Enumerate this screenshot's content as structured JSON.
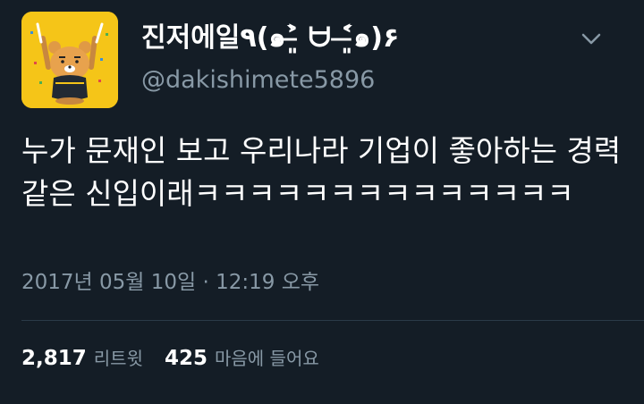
{
  "tweet": {
    "author": {
      "display_name": "진저에일٩(๑˃̶͈̀ ᗨ ˂̶͈́๑)۶",
      "handle": "@dakishimete5896",
      "avatar_icon": "ryan-character-avatar"
    },
    "menu_icon": "chevron-down-icon",
    "text": "누가 문재인 보고 우리나라 기업이 좋아하는 경력같은 신입이래ㅋㅋㅋㅋㅋㅋㅋㅋㅋㅋㅋㅋㅋㅋ",
    "timestamp": "2017년 05월 10일 · 12:19 오후",
    "stats": {
      "retweets_count": "2,817",
      "retweets_label": "리트윗",
      "likes_count": "425",
      "likes_label": "마음에 들어요"
    }
  },
  "colors": {
    "background": "#141d26",
    "primary_text": "#ffffff",
    "secondary_text": "#8899a6",
    "avatar_bg": "#f5c518"
  }
}
